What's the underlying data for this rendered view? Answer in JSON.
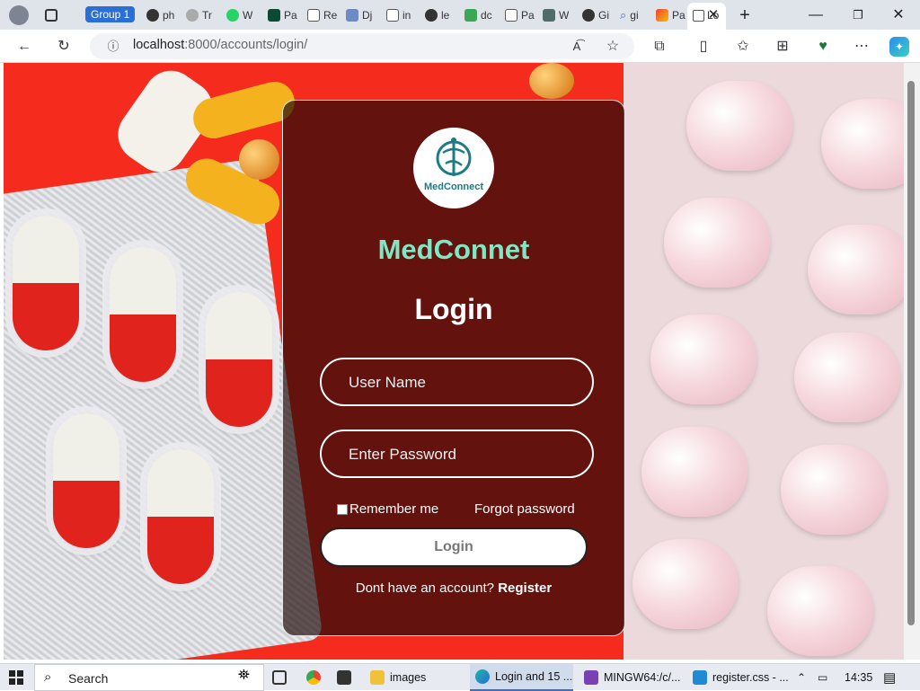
{
  "browser": {
    "group_label": "Group 1",
    "tabs": [
      {
        "label": "ph",
        "icon": "github-icon"
      },
      {
        "label": "Tr",
        "icon": "globe-icon"
      },
      {
        "label": "W",
        "icon": "whatsapp-icon"
      },
      {
        "label": "Pa",
        "icon": "django-icon"
      },
      {
        "label": "Re",
        "icon": "doc-icon"
      },
      {
        "label": "Dj",
        "icon": "docs-icon"
      },
      {
        "label": "in",
        "icon": "file-icon"
      },
      {
        "label": "le",
        "icon": "github-icon"
      },
      {
        "label": "dc",
        "icon": "sheets-icon"
      },
      {
        "label": "Pa",
        "icon": "doc-icon"
      },
      {
        "label": "W",
        "icon": "django-icon"
      },
      {
        "label": "Gi",
        "icon": "github-icon"
      },
      {
        "label": "gi",
        "icon": "search-icon"
      },
      {
        "label": "Pa",
        "icon": "gmail-icon"
      },
      {
        "label": "Lo",
        "icon": "tab-icon"
      }
    ],
    "url_host": "localhost",
    "url_rest": ":8000/accounts/login/"
  },
  "login": {
    "logo_text": "MedConnect",
    "brand": "MedConnet",
    "title": "Login",
    "username_placeholder": "User Name",
    "password_placeholder": "Enter Password",
    "remember_label": "Remember me",
    "forgot_label": "Forgot password",
    "login_button": "Login",
    "register_prompt": "Dont have an account?",
    "register_link": "Register"
  },
  "taskbar": {
    "search_label": "Search",
    "items": [
      {
        "label": "images"
      },
      {
        "label": "Login and 15 ..."
      },
      {
        "label": "MINGW64:/c/..."
      },
      {
        "label": "register.css - ..."
      }
    ],
    "time": "14:35"
  },
  "colors": {
    "brand": "#7fe8c2",
    "page_bg": "#f42b1d",
    "tab_group": "#2b6fd6"
  }
}
